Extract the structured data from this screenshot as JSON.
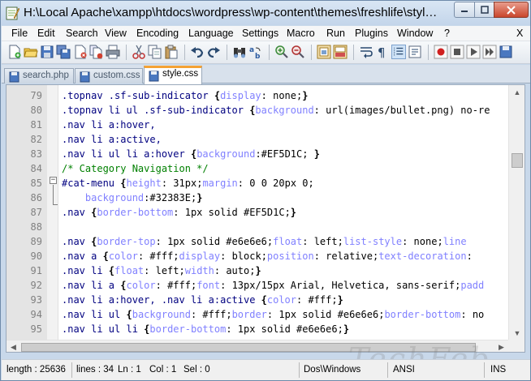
{
  "window": {
    "title": "H:\\Local Apache\\xampp\\htdocs\\wordpress\\wp-content\\themes\\freshlife\\styl…"
  },
  "menu": [
    "File",
    "Edit",
    "Search",
    "View",
    "Encoding",
    "Language",
    "Settings",
    "Macro",
    "Run",
    "Plugins",
    "Window",
    "?"
  ],
  "menu_close": "X",
  "toolbar": [
    "new-file-icon",
    "open-file-icon",
    "save-icon",
    "save-all-icon",
    "close-icon",
    "close-all-icon",
    "print-icon",
    "cut-icon",
    "copy-icon",
    "paste-icon",
    "undo-icon",
    "redo-icon",
    "find-icon",
    "replace-icon",
    "zoom-in-icon",
    "zoom-out-icon",
    "sync-vertical-icon",
    "sync-horizontal-icon",
    "word-wrap-icon",
    "show-all-chars-icon",
    "indent-guide-icon",
    "record-macro-icon",
    "stop-macro-icon",
    "play-macro-icon"
  ],
  "tabs": [
    {
      "label": "search.php",
      "active": false
    },
    {
      "label": "custom.css",
      "active": false
    },
    {
      "label": "style.css",
      "active": true
    }
  ],
  "editor": {
    "lines": [
      {
        "num": "79",
        "segments": [
          [
            "sel",
            ".topnav .sf-sub-indicator "
          ],
          [
            "brace",
            "{"
          ],
          [
            "prop",
            "display"
          ],
          [
            "punct",
            ": "
          ],
          [
            "val",
            "none"
          ],
          [
            "punct",
            ";"
          ],
          [
            "brace",
            "}"
          ]
        ]
      },
      {
        "num": "80",
        "segments": [
          [
            "sel",
            ".topnav li ul .sf-sub-indicator "
          ],
          [
            "brace",
            "{"
          ],
          [
            "prop",
            "background"
          ],
          [
            "punct",
            ": "
          ],
          [
            "val",
            "url(images/bullet.png) no-re"
          ]
        ]
      },
      {
        "num": "81",
        "segments": [
          [
            "sel",
            ".nav li a:hover,"
          ]
        ]
      },
      {
        "num": "82",
        "segments": [
          [
            "sel",
            ".nav li a:active,"
          ]
        ]
      },
      {
        "num": "83",
        "segments": [
          [
            "sel",
            ".nav li ul li a:hover "
          ],
          [
            "brace",
            "{"
          ],
          [
            "prop",
            "background"
          ],
          [
            "punct",
            ":"
          ],
          [
            "val",
            "#EF5D1C"
          ],
          [
            "punct",
            "; "
          ],
          [
            "brace",
            "}"
          ]
        ]
      },
      {
        "num": "84",
        "segments": [
          [
            "comment",
            "/* Category Navigation */"
          ]
        ]
      },
      {
        "num": "85",
        "segments": [
          [
            "id",
            "#cat-menu "
          ],
          [
            "brace",
            "{"
          ],
          [
            "prop",
            "height"
          ],
          [
            "punct",
            ": "
          ],
          [
            "val",
            "31px"
          ],
          [
            "punct",
            ";"
          ],
          [
            "prop",
            "margin"
          ],
          [
            "punct",
            ": "
          ],
          [
            "val",
            "0 0 20px 0"
          ],
          [
            "punct",
            ";"
          ]
        ]
      },
      {
        "num": "86",
        "segments": [
          [
            "val",
            "    "
          ],
          [
            "prop",
            "background"
          ],
          [
            "punct",
            ":"
          ],
          [
            "val",
            "#32383E"
          ],
          [
            "punct",
            ";"
          ],
          [
            "brace",
            "}"
          ]
        ]
      },
      {
        "num": "87",
        "segments": [
          [
            "sel",
            ".nav "
          ],
          [
            "brace",
            "{"
          ],
          [
            "prop",
            "border-bottom"
          ],
          [
            "punct",
            ": "
          ],
          [
            "val",
            "1px solid #EF5D1C"
          ],
          [
            "punct",
            ";"
          ],
          [
            "brace",
            "}"
          ]
        ]
      },
      {
        "num": "88",
        "segments": []
      },
      {
        "num": "89",
        "segments": [
          [
            "sel",
            ".nav "
          ],
          [
            "brace",
            "{"
          ],
          [
            "prop",
            "border-top"
          ],
          [
            "punct",
            ": "
          ],
          [
            "val",
            "1px solid #e6e6e6"
          ],
          [
            "punct",
            ";"
          ],
          [
            "prop",
            "float"
          ],
          [
            "punct",
            ": "
          ],
          [
            "val",
            "left"
          ],
          [
            "punct",
            ";"
          ],
          [
            "prop",
            "list-style"
          ],
          [
            "punct",
            ": "
          ],
          [
            "val",
            "none"
          ],
          [
            "punct",
            ";"
          ],
          [
            "prop",
            "line"
          ]
        ]
      },
      {
        "num": "90",
        "segments": [
          [
            "sel",
            ".nav a "
          ],
          [
            "brace",
            "{"
          ],
          [
            "prop",
            "color"
          ],
          [
            "punct",
            ": "
          ],
          [
            "val",
            "#fff"
          ],
          [
            "punct",
            ";"
          ],
          [
            "prop",
            "display"
          ],
          [
            "punct",
            ": "
          ],
          [
            "val",
            "block"
          ],
          [
            "punct",
            ";"
          ],
          [
            "prop",
            "position"
          ],
          [
            "punct",
            ": "
          ],
          [
            "val",
            "relative"
          ],
          [
            "punct",
            ";"
          ],
          [
            "prop",
            "text-decoration"
          ],
          [
            "punct",
            ":"
          ]
        ]
      },
      {
        "num": "91",
        "segments": [
          [
            "sel",
            ".nav li "
          ],
          [
            "brace",
            "{"
          ],
          [
            "prop",
            "float"
          ],
          [
            "punct",
            ": "
          ],
          [
            "val",
            "left"
          ],
          [
            "punct",
            ";"
          ],
          [
            "prop",
            "width"
          ],
          [
            "punct",
            ": "
          ],
          [
            "val",
            "auto"
          ],
          [
            "punct",
            ";"
          ],
          [
            "brace",
            "}"
          ]
        ]
      },
      {
        "num": "92",
        "segments": [
          [
            "sel",
            ".nav li a "
          ],
          [
            "brace",
            "{"
          ],
          [
            "prop",
            "color"
          ],
          [
            "punct",
            ": "
          ],
          [
            "val",
            "#fff"
          ],
          [
            "punct",
            ";"
          ],
          [
            "prop",
            "font"
          ],
          [
            "punct",
            ": "
          ],
          [
            "val",
            "13px/15px Arial, Helvetica, sans-serif"
          ],
          [
            "punct",
            ";"
          ],
          [
            "prop",
            "padd"
          ]
        ]
      },
      {
        "num": "93",
        "segments": [
          [
            "sel",
            ".nav li a:hover, .nav li a:active "
          ],
          [
            "brace",
            "{"
          ],
          [
            "prop",
            "color"
          ],
          [
            "punct",
            ": "
          ],
          [
            "val",
            "#fff"
          ],
          [
            "punct",
            ";"
          ],
          [
            "brace",
            "}"
          ]
        ]
      },
      {
        "num": "94",
        "segments": [
          [
            "sel",
            ".nav li ul "
          ],
          [
            "brace",
            "{"
          ],
          [
            "prop",
            "background"
          ],
          [
            "punct",
            ": "
          ],
          [
            "val",
            "#fff"
          ],
          [
            "punct",
            ";"
          ],
          [
            "prop",
            "border"
          ],
          [
            "punct",
            ": "
          ],
          [
            "val",
            "1px solid #e6e6e6"
          ],
          [
            "punct",
            ";"
          ],
          [
            "prop",
            "border-bottom"
          ],
          [
            "punct",
            ": "
          ],
          [
            "val",
            "no"
          ]
        ]
      },
      {
        "num": "95",
        "segments": [
          [
            "sel",
            ".nav li ul li "
          ],
          [
            "brace",
            "{"
          ],
          [
            "prop",
            "border-bottom"
          ],
          [
            "punct",
            ": "
          ],
          [
            "val",
            "1px solid #e6e6e6"
          ],
          [
            "punct",
            ";"
          ],
          [
            "brace",
            "}"
          ]
        ]
      }
    ]
  },
  "status": {
    "length": "length : 25636",
    "lines": "lines : 34",
    "ln": "Ln : 1",
    "col": "Col : 1",
    "sel": "Sel : 0",
    "eol": "Dos\\Windows",
    "encoding": "ANSI",
    "mode": "INS"
  },
  "watermark": "TechFeb"
}
